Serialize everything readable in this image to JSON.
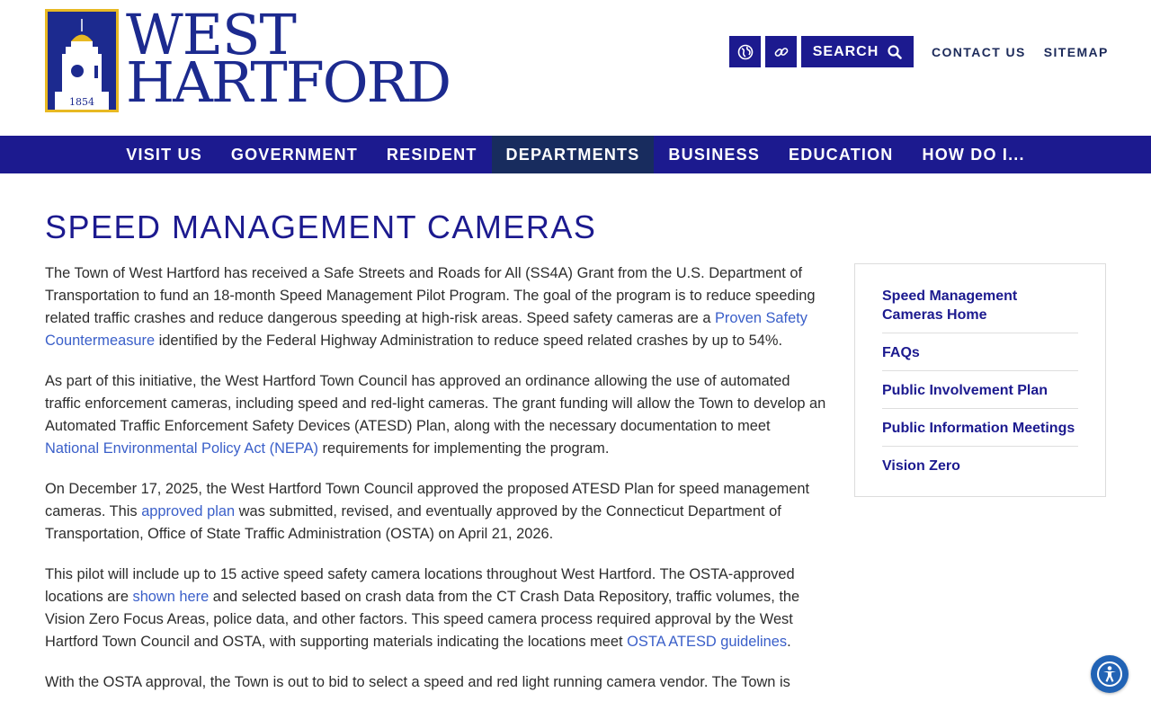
{
  "header": {
    "logo_line1": "WEST",
    "logo_line2": "HARTFORD",
    "seal_year": "1854",
    "utility": {
      "search_label": "SEARCH",
      "contact_label": "CONTACT US",
      "sitemap_label": "SITEMAP",
      "icons": [
        "globe-icon",
        "link-icon",
        "search-icon"
      ]
    }
  },
  "nav": {
    "items": [
      {
        "label": "VISIT US"
      },
      {
        "label": "GOVERNMENT"
      },
      {
        "label": "RESIDENT"
      },
      {
        "label": "DEPARTMENTS",
        "active": true
      },
      {
        "label": "BUSINESS"
      },
      {
        "label": "EDUCATION"
      },
      {
        "label": "HOW DO I..."
      }
    ]
  },
  "page": {
    "title": "SPEED MANAGEMENT CAMERAS",
    "p1": {
      "a": "The Town of West Hartford has received a Safe Streets and Roads for All (SS4A) Grant from the U.S. Department of Transportation to fund an 18-month Speed Management Pilot Program. The goal of the program is to reduce speeding related traffic crashes and reduce dangerous speeding at high-risk areas. Speed safety cameras are a ",
      "link": "Proven Safety Countermeasure",
      "b": " identified by the Federal Highway Administration to reduce speed related crashes by up to 54%."
    },
    "p2": {
      "a": "As part of this initiative, the West Hartford Town Council has approved an ordinance allowing the use of automated traffic enforcement cameras, including speed and red-light cameras. The grant funding will allow the Town to develop an Automated Traffic Enforcement Safety Devices (ATESD) Plan, along with the necessary documentation to meet ",
      "link": "National Environmental Policy Act (NEPA)",
      "b": " requirements for implementing the program."
    },
    "p3": {
      "a": "On December 17, 2025, the West Hartford Town Council approved the proposed ATESD Plan for speed management cameras. This ",
      "link": "approved plan",
      "b": " was submitted, revised, and eventually approved by the Connecticut Department of Transportation, Office of State Traffic Administration (OSTA) on April 21, 2026."
    },
    "p4": {
      "a": "This pilot will include up to 15 active speed safety camera locations throughout West Hartford. The OSTA-approved locations are ",
      "link1": "shown here",
      "b": " and selected based on crash data from the CT Crash Data Repository, traffic volumes, the Vision Zero Focus Areas, police data, and other factors. This speed camera process required approval by the West Hartford Town Council and OSTA, with supporting materials indicating the locations meet ",
      "link2": "OSTA ATESD guidelines",
      "c": "."
    },
    "p5": {
      "a": "With the OSTA approval, the Town is out to bid to select a speed and red light running camera vendor. The Town is"
    }
  },
  "sidebar": {
    "items": [
      {
        "label": "Speed Management Cameras Home"
      },
      {
        "label": "FAQs"
      },
      {
        "label": "Public Involvement Plan"
      },
      {
        "label": "Public Information Meetings"
      },
      {
        "label": "Vision Zero"
      }
    ]
  },
  "colors": {
    "brand_blue": "#1c1a8f",
    "active_nav": "#182c5e",
    "link": "#3a5fc9",
    "seal_gold": "#e8b923",
    "a11y_blue": "#2163b5"
  }
}
